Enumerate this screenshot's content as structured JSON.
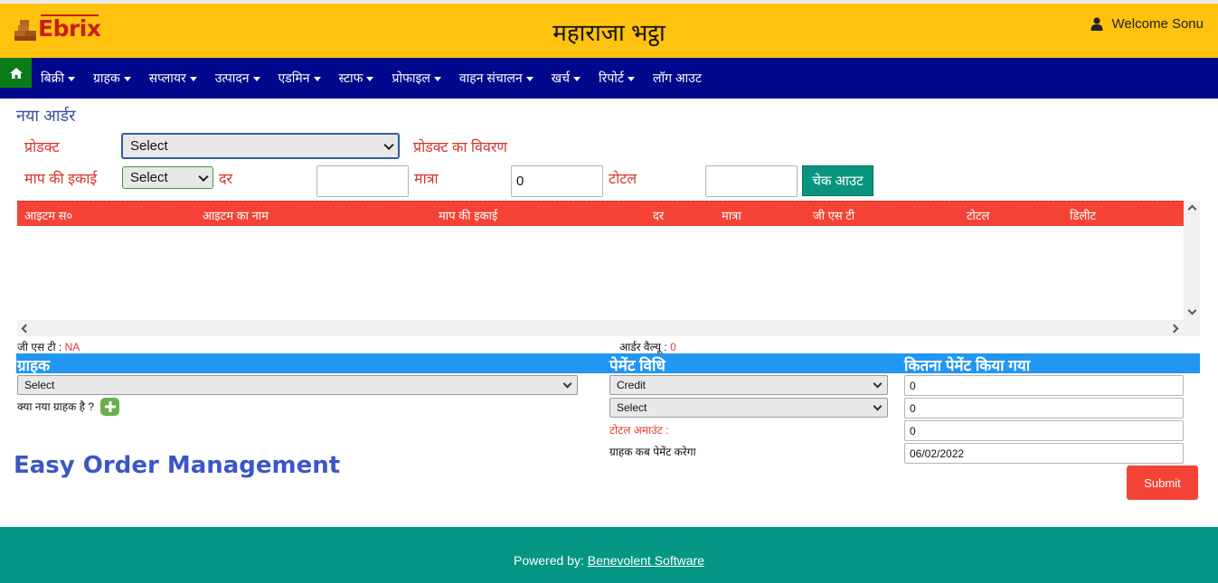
{
  "header": {
    "logo_text": "Ebrix",
    "title": "महाराजा भट्ठा",
    "welcome": "Welcome Sonu",
    "user_icon": "user-icon"
  },
  "nav": {
    "home_icon": "home-icon",
    "items": [
      {
        "label": "बिक्री"
      },
      {
        "label": "ग्राहक"
      },
      {
        "label": "सप्लायर"
      },
      {
        "label": "उत्पादन"
      },
      {
        "label": "एडमिन"
      },
      {
        "label": "स्टाफ"
      },
      {
        "label": "प्रोफाइल"
      },
      {
        "label": "वाहन संचालन"
      },
      {
        "label": "खर्च"
      },
      {
        "label": "रिपोर्ट"
      },
      {
        "label": "लॉग आउट"
      }
    ]
  },
  "order": {
    "section_title": "नया आर्डर",
    "product_label": "प्रोडक्ट",
    "product_select": "Select",
    "product_desc_label": "प्रोडक्ट का विवरण",
    "unit_label": "माप की इकाई",
    "unit_select": "Select",
    "rate_label": "दर",
    "rate_value": "",
    "qty_label": "मात्रा",
    "qty_value": "0",
    "total_label": "टोटल",
    "total_value": "",
    "checkout_label": "चेक आउट"
  },
  "table": {
    "columns": [
      "आइटम स०",
      "आइटम का नाम",
      "माप की इकाई",
      "दर",
      "मात्रा",
      "जी एस टी",
      "टोटल",
      "डिलीट"
    ],
    "rows": []
  },
  "summary": {
    "gst_label": "जी एस टी :",
    "gst_value": "NA",
    "order_value_label": "आर्डर वैल्यू :",
    "order_value": "0"
  },
  "payment": {
    "customer_header": "ग्राहक",
    "method_header": "पेमेंट विधि",
    "paid_header": "कितना पेमेंट किया गया",
    "customer_select": "Select",
    "new_customer_label": "क्या नया ग्राहक है ?",
    "method_select_1": "Credit",
    "method_select_2": "Select",
    "paid_value_1": "0",
    "paid_value_2": "0",
    "total_amount_label": "टोटल अमाउंट :",
    "total_amount_value": "0",
    "due_label": "ग्राहक कब पेमेंट करेगा",
    "due_date": "06/02/2022",
    "submit_label": "Submit"
  },
  "tagline": "Easy Order Management",
  "footer": {
    "powered_by": "Powered by:",
    "company": "Benevolent Software"
  },
  "colors": {
    "header_bg": "#ffc20e",
    "nav_bg": "#02088c",
    "table_head": "#f44336",
    "blue_bar": "#2196f3",
    "footer_bg": "#049684",
    "accent_teal": "#08957d"
  }
}
